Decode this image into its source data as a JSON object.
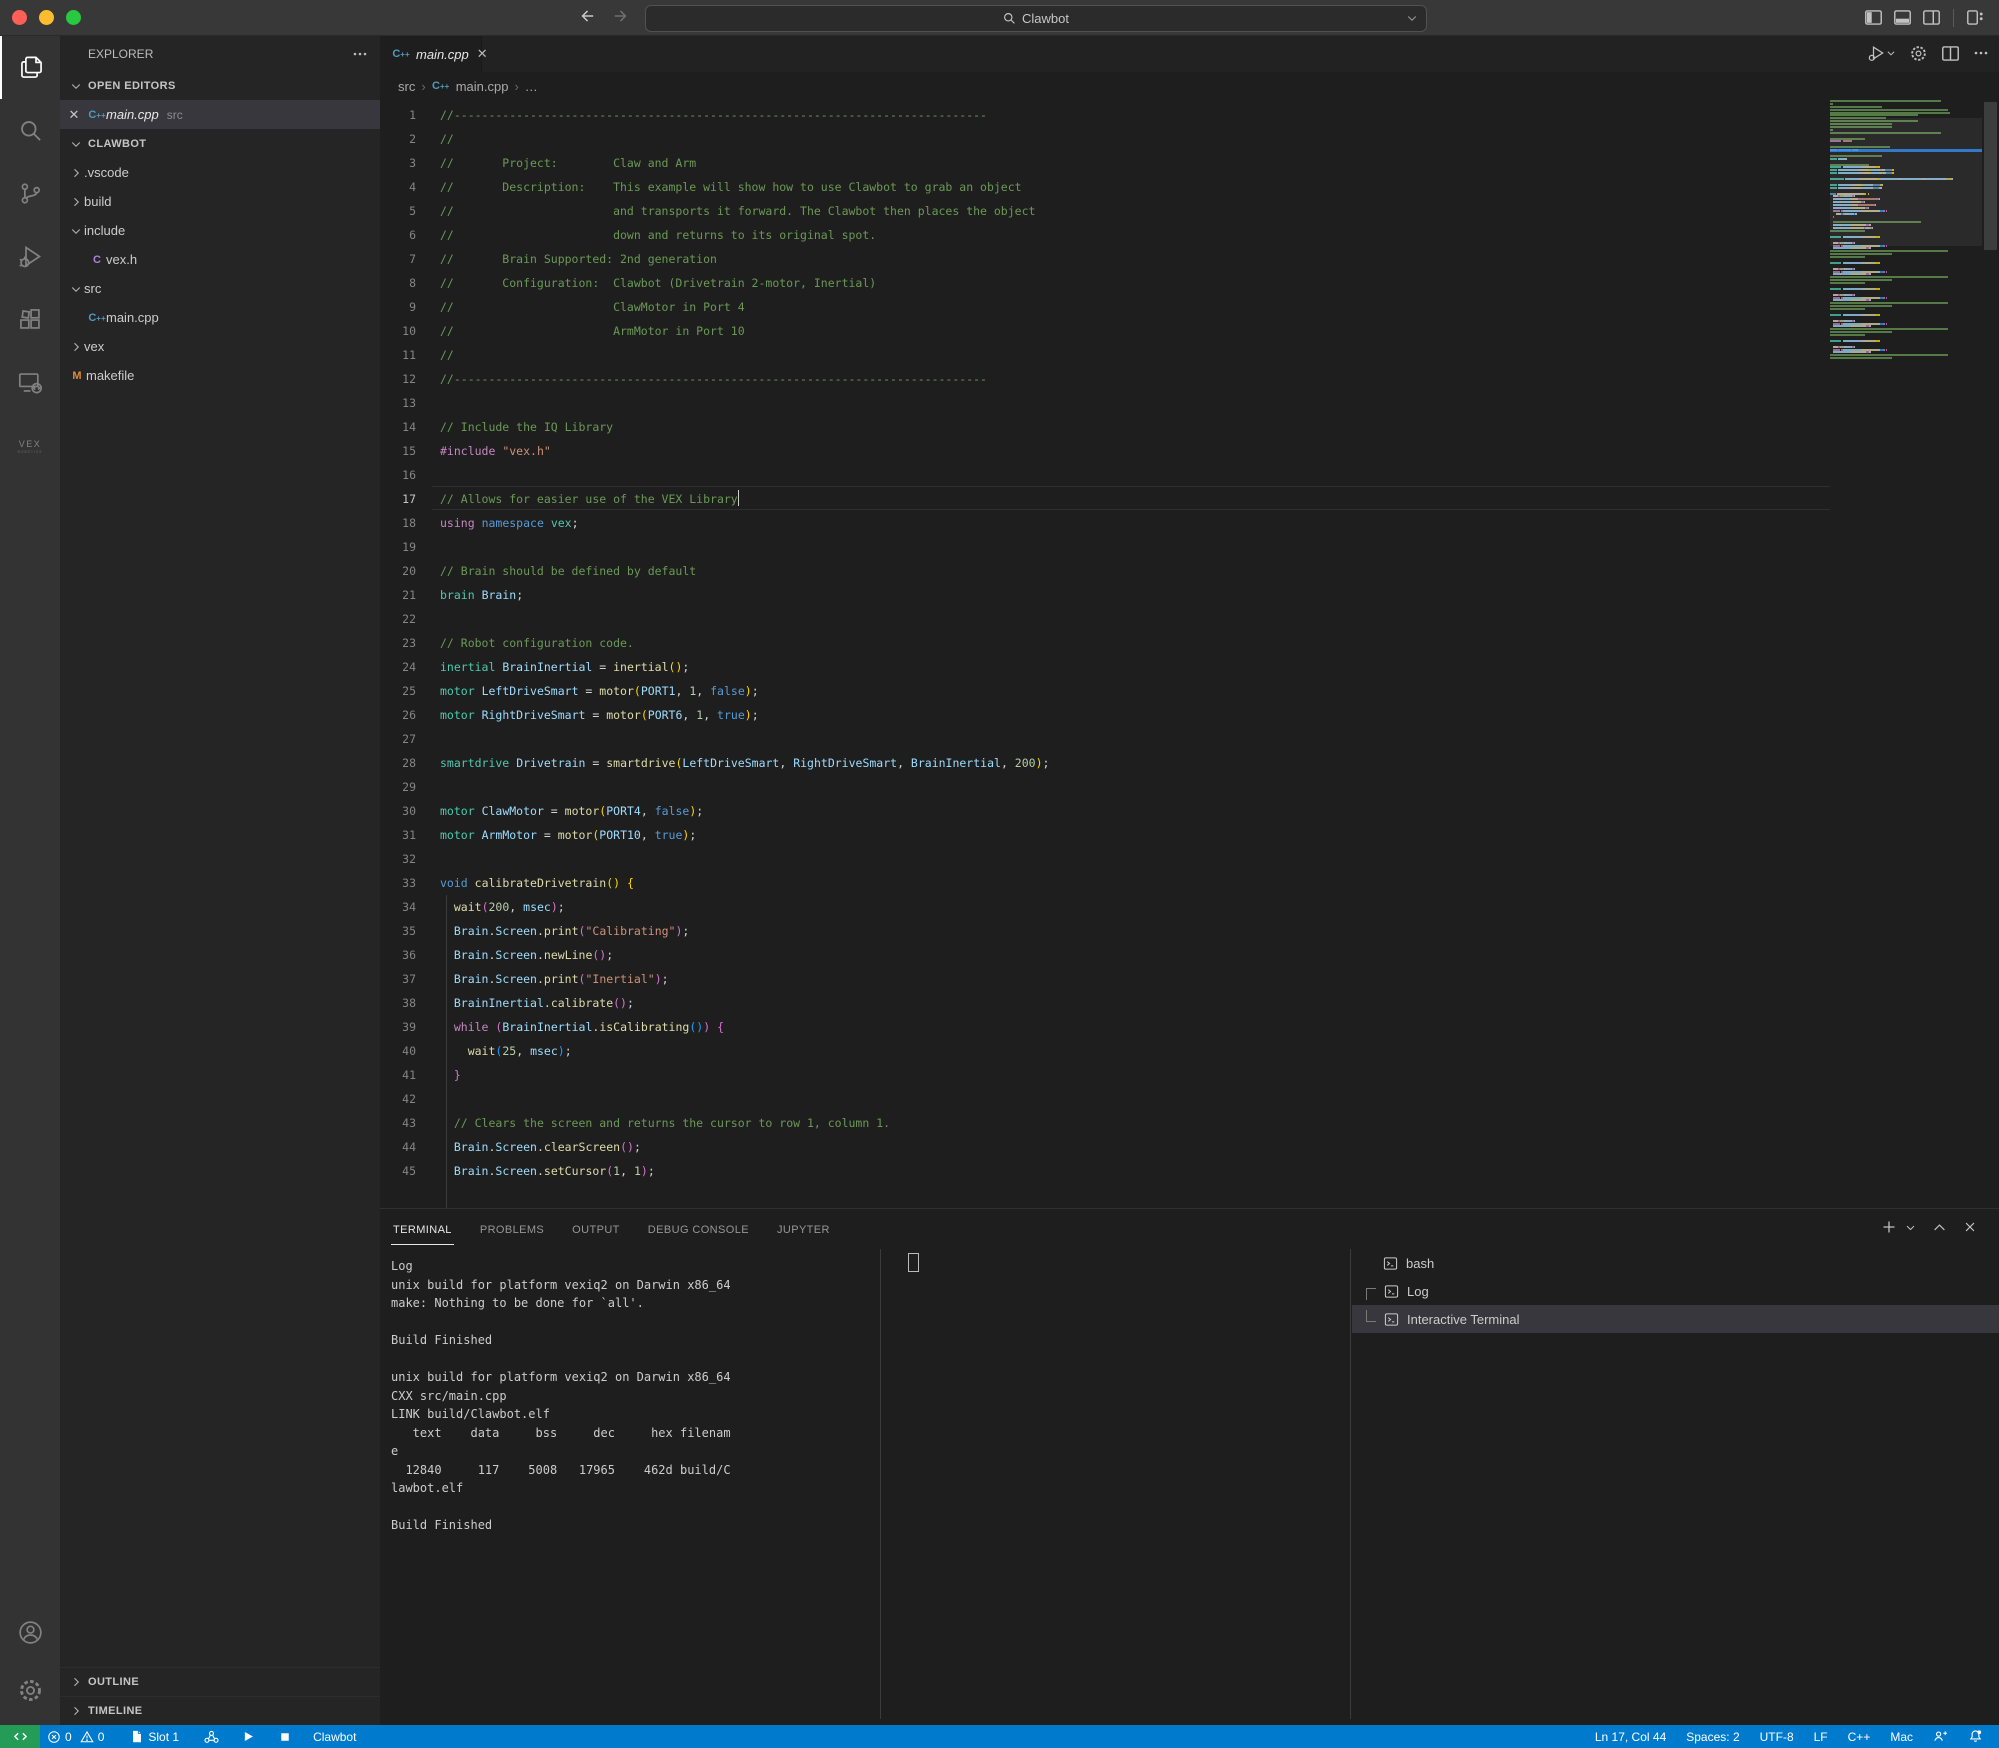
{
  "titlebar": {
    "search_value": "Clawbot"
  },
  "activity_bar": {
    "items": [
      "explorer",
      "search",
      "source-control",
      "run-and-debug",
      "extensions",
      "remote-explorer",
      "vex"
    ],
    "bottom_items": [
      "accounts",
      "settings"
    ],
    "active": "explorer"
  },
  "sidebar": {
    "title": "EXPLORER",
    "open_editors": {
      "label": "OPEN EDITORS",
      "item": {
        "label": "main.cpp",
        "detail": "src"
      }
    },
    "project": {
      "label": "CLAWBOT"
    },
    "tree": [
      {
        "label": ".vscode",
        "kind": "folder",
        "expanded": false,
        "indent": 0
      },
      {
        "label": "build",
        "kind": "folder",
        "expanded": false,
        "indent": 0
      },
      {
        "label": "include",
        "kind": "folder",
        "expanded": true,
        "indent": 0
      },
      {
        "label": "vex.h",
        "kind": "file-c",
        "indent": 1
      },
      {
        "label": "src",
        "kind": "folder",
        "expanded": true,
        "indent": 0
      },
      {
        "label": "main.cpp",
        "kind": "file-cpp",
        "indent": 1
      },
      {
        "label": "vex",
        "kind": "folder",
        "expanded": false,
        "indent": 0
      },
      {
        "label": "makefile",
        "kind": "file-m",
        "indent": 0
      }
    ],
    "bottom_sections": [
      "OUTLINE",
      "TIMELINE"
    ]
  },
  "editor": {
    "tab": {
      "label": "main.cpp"
    },
    "breadcrumbs": [
      "src",
      "main.cpp",
      "…"
    ],
    "syntax_colors": {
      "c": "#6A9955",
      "kc": "#C586C0",
      "kb": "#569CD6",
      "kp": "#C586C0",
      "ty": "#4EC9B0",
      "v": "#9CDCFE",
      "fn": "#DCDCAA",
      "n": "#B5CEA8",
      "s": "#CE9178",
      "w": "#D4D4D4",
      "b1": "#FFD700",
      "b2": "#DA70D6",
      "b3": "#179FFF"
    },
    "code": {
      "cursor_line": 17,
      "lines": [
        {
          "t": [
            [
              "c",
              "//-----------------------------------------------------------------------------"
            ]
          ]
        },
        {
          "t": [
            [
              "c",
              "//"
            ]
          ]
        },
        {
          "t": [
            [
              "c",
              "//       Project:        Claw and Arm"
            ]
          ]
        },
        {
          "t": [
            [
              "c",
              "//       Description:    This example will show how to use Clawbot to grab an object"
            ]
          ]
        },
        {
          "t": [
            [
              "c",
              "//                       and transports it forward. The Clawbot then places the object"
            ]
          ]
        },
        {
          "t": [
            [
              "c",
              "//                       down and returns to its original spot."
            ]
          ]
        },
        {
          "t": [
            [
              "c",
              "//       Brain Supported: 2nd generation"
            ]
          ]
        },
        {
          "t": [
            [
              "c",
              "//       Configuration:  Clawbot (Drivetrain 2-motor, Inertial)"
            ]
          ]
        },
        {
          "t": [
            [
              "c",
              "//                       ClawMotor in Port 4"
            ]
          ]
        },
        {
          "t": [
            [
              "c",
              "//                       ArmMotor in Port 10"
            ]
          ]
        },
        {
          "t": [
            [
              "c",
              "//"
            ]
          ]
        },
        {
          "t": [
            [
              "c",
              "//-----------------------------------------------------------------------------"
            ]
          ]
        },
        {
          "t": []
        },
        {
          "t": [
            [
              "c",
              "// Include the IQ Library"
            ]
          ]
        },
        {
          "t": [
            [
              "kp",
              "#include"
            ],
            [
              "w",
              " "
            ],
            [
              "s",
              "\"vex.h\""
            ]
          ]
        },
        {
          "t": []
        },
        {
          "t": [
            [
              "c",
              "// Allows for easier use of the VEX Library"
            ]
          ]
        },
        {
          "t": [
            [
              "kc",
              "using"
            ],
            [
              "w",
              " "
            ],
            [
              "kb",
              "namespace"
            ],
            [
              "w",
              " "
            ],
            [
              "ty",
              "vex"
            ],
            [
              "w",
              ";"
            ]
          ]
        },
        {
          "t": []
        },
        {
          "t": [
            [
              "c",
              "// Brain should be defined by default"
            ]
          ]
        },
        {
          "t": [
            [
              "ty",
              "brain"
            ],
            [
              "w",
              " "
            ],
            [
              "v",
              "Brain"
            ],
            [
              "w",
              ";"
            ]
          ]
        },
        {
          "t": []
        },
        {
          "t": [
            [
              "c",
              "// Robot configuration code."
            ]
          ]
        },
        {
          "t": [
            [
              "ty",
              "inertial"
            ],
            [
              "w",
              " "
            ],
            [
              "v",
              "BrainInertial"
            ],
            [
              "w",
              " = "
            ],
            [
              "fn",
              "inertial"
            ],
            [
              "b1",
              "()"
            ],
            [
              "w",
              ";"
            ]
          ]
        },
        {
          "t": [
            [
              "ty",
              "motor"
            ],
            [
              "w",
              " "
            ],
            [
              "v",
              "LeftDriveSmart"
            ],
            [
              "w",
              " = "
            ],
            [
              "fn",
              "motor"
            ],
            [
              "b1",
              "("
            ],
            [
              "v",
              "PORT1"
            ],
            [
              "w",
              ", "
            ],
            [
              "n",
              "1"
            ],
            [
              "w",
              ", "
            ],
            [
              "kb",
              "false"
            ],
            [
              "b1",
              ")"
            ],
            [
              "w",
              ";"
            ]
          ]
        },
        {
          "t": [
            [
              "ty",
              "motor"
            ],
            [
              "w",
              " "
            ],
            [
              "v",
              "RightDriveSmart"
            ],
            [
              "w",
              " = "
            ],
            [
              "fn",
              "motor"
            ],
            [
              "b1",
              "("
            ],
            [
              "v",
              "PORT6"
            ],
            [
              "w",
              ", "
            ],
            [
              "n",
              "1"
            ],
            [
              "w",
              ", "
            ],
            [
              "kb",
              "true"
            ],
            [
              "b1",
              ")"
            ],
            [
              "w",
              ";"
            ]
          ]
        },
        {
          "t": []
        },
        {
          "t": [
            [
              "ty",
              "smartdrive"
            ],
            [
              "w",
              " "
            ],
            [
              "v",
              "Drivetrain"
            ],
            [
              "w",
              " = "
            ],
            [
              "fn",
              "smartdrive"
            ],
            [
              "b1",
              "("
            ],
            [
              "v",
              "LeftDriveSmart"
            ],
            [
              "w",
              ", "
            ],
            [
              "v",
              "RightDriveSmart"
            ],
            [
              "w",
              ", "
            ],
            [
              "v",
              "BrainInertial"
            ],
            [
              "w",
              ", "
            ],
            [
              "n",
              "200"
            ],
            [
              "b1",
              ")"
            ],
            [
              "w",
              ";"
            ]
          ]
        },
        {
          "t": []
        },
        {
          "t": [
            [
              "ty",
              "motor"
            ],
            [
              "w",
              " "
            ],
            [
              "v",
              "ClawMotor"
            ],
            [
              "w",
              " = "
            ],
            [
              "fn",
              "motor"
            ],
            [
              "b1",
              "("
            ],
            [
              "v",
              "PORT4"
            ],
            [
              "w",
              ", "
            ],
            [
              "kb",
              "false"
            ],
            [
              "b1",
              ")"
            ],
            [
              "w",
              ";"
            ]
          ]
        },
        {
          "t": [
            [
              "ty",
              "motor"
            ],
            [
              "w",
              " "
            ],
            [
              "v",
              "ArmMotor"
            ],
            [
              "w",
              " = "
            ],
            [
              "fn",
              "motor"
            ],
            [
              "b1",
              "("
            ],
            [
              "v",
              "PORT10"
            ],
            [
              "w",
              ", "
            ],
            [
              "kb",
              "true"
            ],
            [
              "b1",
              ")"
            ],
            [
              "w",
              ";"
            ]
          ]
        },
        {
          "t": []
        },
        {
          "t": [
            [
              "kb",
              "void"
            ],
            [
              "w",
              " "
            ],
            [
              "fn",
              "calibrateDrivetrain"
            ],
            [
              "b1",
              "()"
            ],
            [
              "w",
              " "
            ],
            [
              "b1",
              "{"
            ]
          ]
        },
        {
          "t": [
            [
              "w",
              "  "
            ],
            [
              "fn",
              "wait"
            ],
            [
              "b2",
              "("
            ],
            [
              "n",
              "200"
            ],
            [
              "w",
              ", "
            ],
            [
              "v",
              "msec"
            ],
            [
              "b2",
              ")"
            ],
            [
              "w",
              ";"
            ]
          ]
        },
        {
          "t": [
            [
              "w",
              "  "
            ],
            [
              "v",
              "Brain"
            ],
            [
              "w",
              "."
            ],
            [
              "v",
              "Screen"
            ],
            [
              "w",
              "."
            ],
            [
              "fn",
              "print"
            ],
            [
              "b2",
              "("
            ],
            [
              "s",
              "\"Calibrating\""
            ],
            [
              "b2",
              ")"
            ],
            [
              "w",
              ";"
            ]
          ]
        },
        {
          "t": [
            [
              "w",
              "  "
            ],
            [
              "v",
              "Brain"
            ],
            [
              "w",
              "."
            ],
            [
              "v",
              "Screen"
            ],
            [
              "w",
              "."
            ],
            [
              "fn",
              "newLine"
            ],
            [
              "b2",
              "()"
            ],
            [
              "w",
              ";"
            ]
          ]
        },
        {
          "t": [
            [
              "w",
              "  "
            ],
            [
              "v",
              "Brain"
            ],
            [
              "w",
              "."
            ],
            [
              "v",
              "Screen"
            ],
            [
              "w",
              "."
            ],
            [
              "fn",
              "print"
            ],
            [
              "b2",
              "("
            ],
            [
              "s",
              "\"Inertial\""
            ],
            [
              "b2",
              ")"
            ],
            [
              "w",
              ";"
            ]
          ]
        },
        {
          "t": [
            [
              "w",
              "  "
            ],
            [
              "v",
              "BrainInertial"
            ],
            [
              "w",
              "."
            ],
            [
              "fn",
              "calibrate"
            ],
            [
              "b2",
              "()"
            ],
            [
              "w",
              ";"
            ]
          ]
        },
        {
          "t": [
            [
              "w",
              "  "
            ],
            [
              "kc",
              "while"
            ],
            [
              "w",
              " "
            ],
            [
              "b2",
              "("
            ],
            [
              "v",
              "BrainInertial"
            ],
            [
              "w",
              "."
            ],
            [
              "fn",
              "isCalibrating"
            ],
            [
              "b3",
              "()"
            ],
            [
              "b2",
              ")"
            ],
            [
              "w",
              " "
            ],
            [
              "b2",
              "{"
            ]
          ]
        },
        {
          "t": [
            [
              "w",
              "    "
            ],
            [
              "fn",
              "wait"
            ],
            [
              "b3",
              "("
            ],
            [
              "n",
              "25"
            ],
            [
              "w",
              ", "
            ],
            [
              "v",
              "msec"
            ],
            [
              "b3",
              ")"
            ],
            [
              "w",
              ";"
            ]
          ]
        },
        {
          "t": [
            [
              "w",
              "  "
            ],
            [
              "b2",
              "}"
            ]
          ]
        },
        {
          "t": []
        },
        {
          "t": [
            [
              "w",
              "  "
            ],
            [
              "c",
              "// Clears the screen and returns the cursor to row 1, column 1."
            ]
          ]
        },
        {
          "t": [
            [
              "w",
              "  "
            ],
            [
              "v",
              "Brain"
            ],
            [
              "w",
              "."
            ],
            [
              "v",
              "Screen"
            ],
            [
              "w",
              "."
            ],
            [
              "fn",
              "clearScreen"
            ],
            [
              "b2",
              "()"
            ],
            [
              "w",
              ";"
            ]
          ]
        },
        {
          "t": [
            [
              "w",
              "  "
            ],
            [
              "v",
              "Brain"
            ],
            [
              "w",
              "."
            ],
            [
              "v",
              "Screen"
            ],
            [
              "w",
              "."
            ],
            [
              "fn",
              "setCursor"
            ],
            [
              "b2",
              "("
            ],
            [
              "n",
              "1"
            ],
            [
              "w",
              ", "
            ],
            [
              "n",
              "1"
            ],
            [
              "b2",
              ")"
            ],
            [
              "w",
              ";"
            ]
          ]
        }
      ]
    }
  },
  "panel": {
    "tabs": [
      {
        "label": "TERMINAL",
        "active": true
      },
      {
        "label": "PROBLEMS",
        "active": false
      },
      {
        "label": "OUTPUT",
        "active": false
      },
      {
        "label": "DEBUG CONSOLE",
        "active": false
      },
      {
        "label": "JUPYTER",
        "active": false
      }
    ],
    "terminal_output": [
      "Log",
      "unix build for platform vexiq2 on Darwin x86_64",
      "make: Nothing to be done for `all'.",
      "",
      "Build Finished",
      "",
      "unix build for platform vexiq2 on Darwin x86_64",
      "CXX src/main.cpp",
      "LINK build/Clawbot.elf",
      "   text    data     bss     dec     hex filenam",
      "e",
      "  12840     117    5008   17965    462d build/C",
      "lawbot.elf",
      "",
      "Build Finished"
    ],
    "terminals": [
      {
        "label": "bash",
        "connector": "none",
        "selected": false
      },
      {
        "label": "Log",
        "connector": "top",
        "selected": false
      },
      {
        "label": "Interactive Terminal",
        "connector": "bottom",
        "selected": true
      }
    ]
  },
  "status_bar": {
    "remote_color": "#249B57",
    "errors": "0",
    "warnings": "0",
    "slot": "Slot 1",
    "project": "Clawbot",
    "right": [
      "Ln 17, Col 44",
      "Spaces: 2",
      "UTF-8",
      "LF",
      "C++",
      "Mac"
    ]
  }
}
